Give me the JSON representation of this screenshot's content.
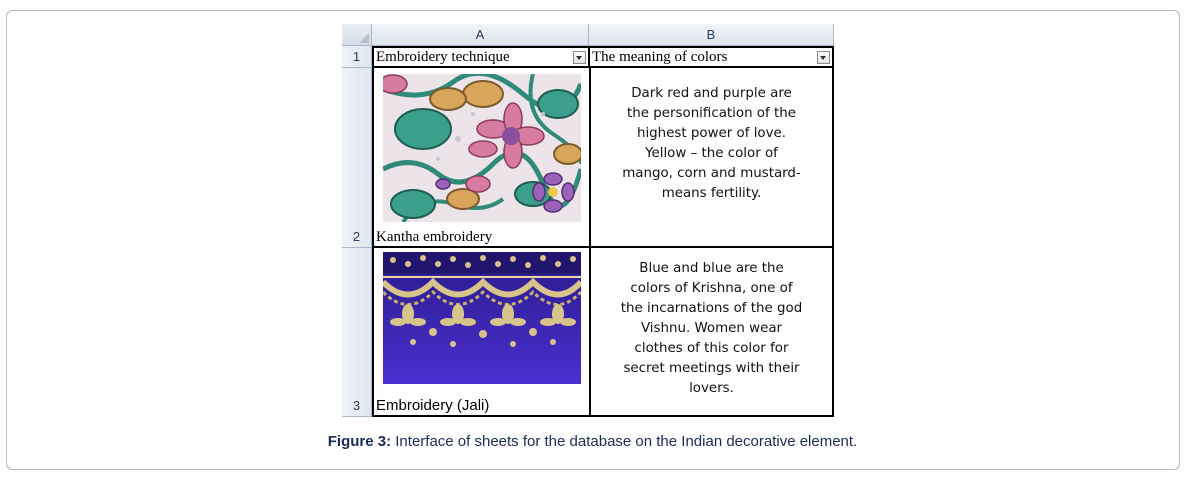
{
  "spreadsheet": {
    "column_headers": [
      "A",
      "B"
    ],
    "row_numbers": [
      "1",
      "2",
      "3"
    ],
    "header_row": {
      "col_a": "Embroidery technique",
      "col_b": "The meaning of colors"
    },
    "rows": [
      {
        "caption": "Kantha embroidery",
        "photo_icon": "kantha-embroidery-photo",
        "meaning": "Dark red and purple are\nthe personification of the\nhighest power of love.\nYellow – the color of\nmango, corn and mustard-\nmeans fertility."
      },
      {
        "caption": "Embroidery (Jali)",
        "photo_icon": "jali-embroidery-photo",
        "meaning": "Blue and blue are the\ncolors of Krishna, one of\nthe incarnations of the god\nVishnu. Women wear\nclothes of this color for\nsecret meetings with their\nlovers."
      }
    ]
  },
  "figure": {
    "label": "Figure 3:",
    "text": " Interface of sheets for the database on the Indian decorative element."
  },
  "colors": {
    "header_text": "#27405f",
    "caption_text": "#1a2a5a",
    "jali_background": "#3d22b8",
    "jali_thread": "#d8c48a"
  }
}
